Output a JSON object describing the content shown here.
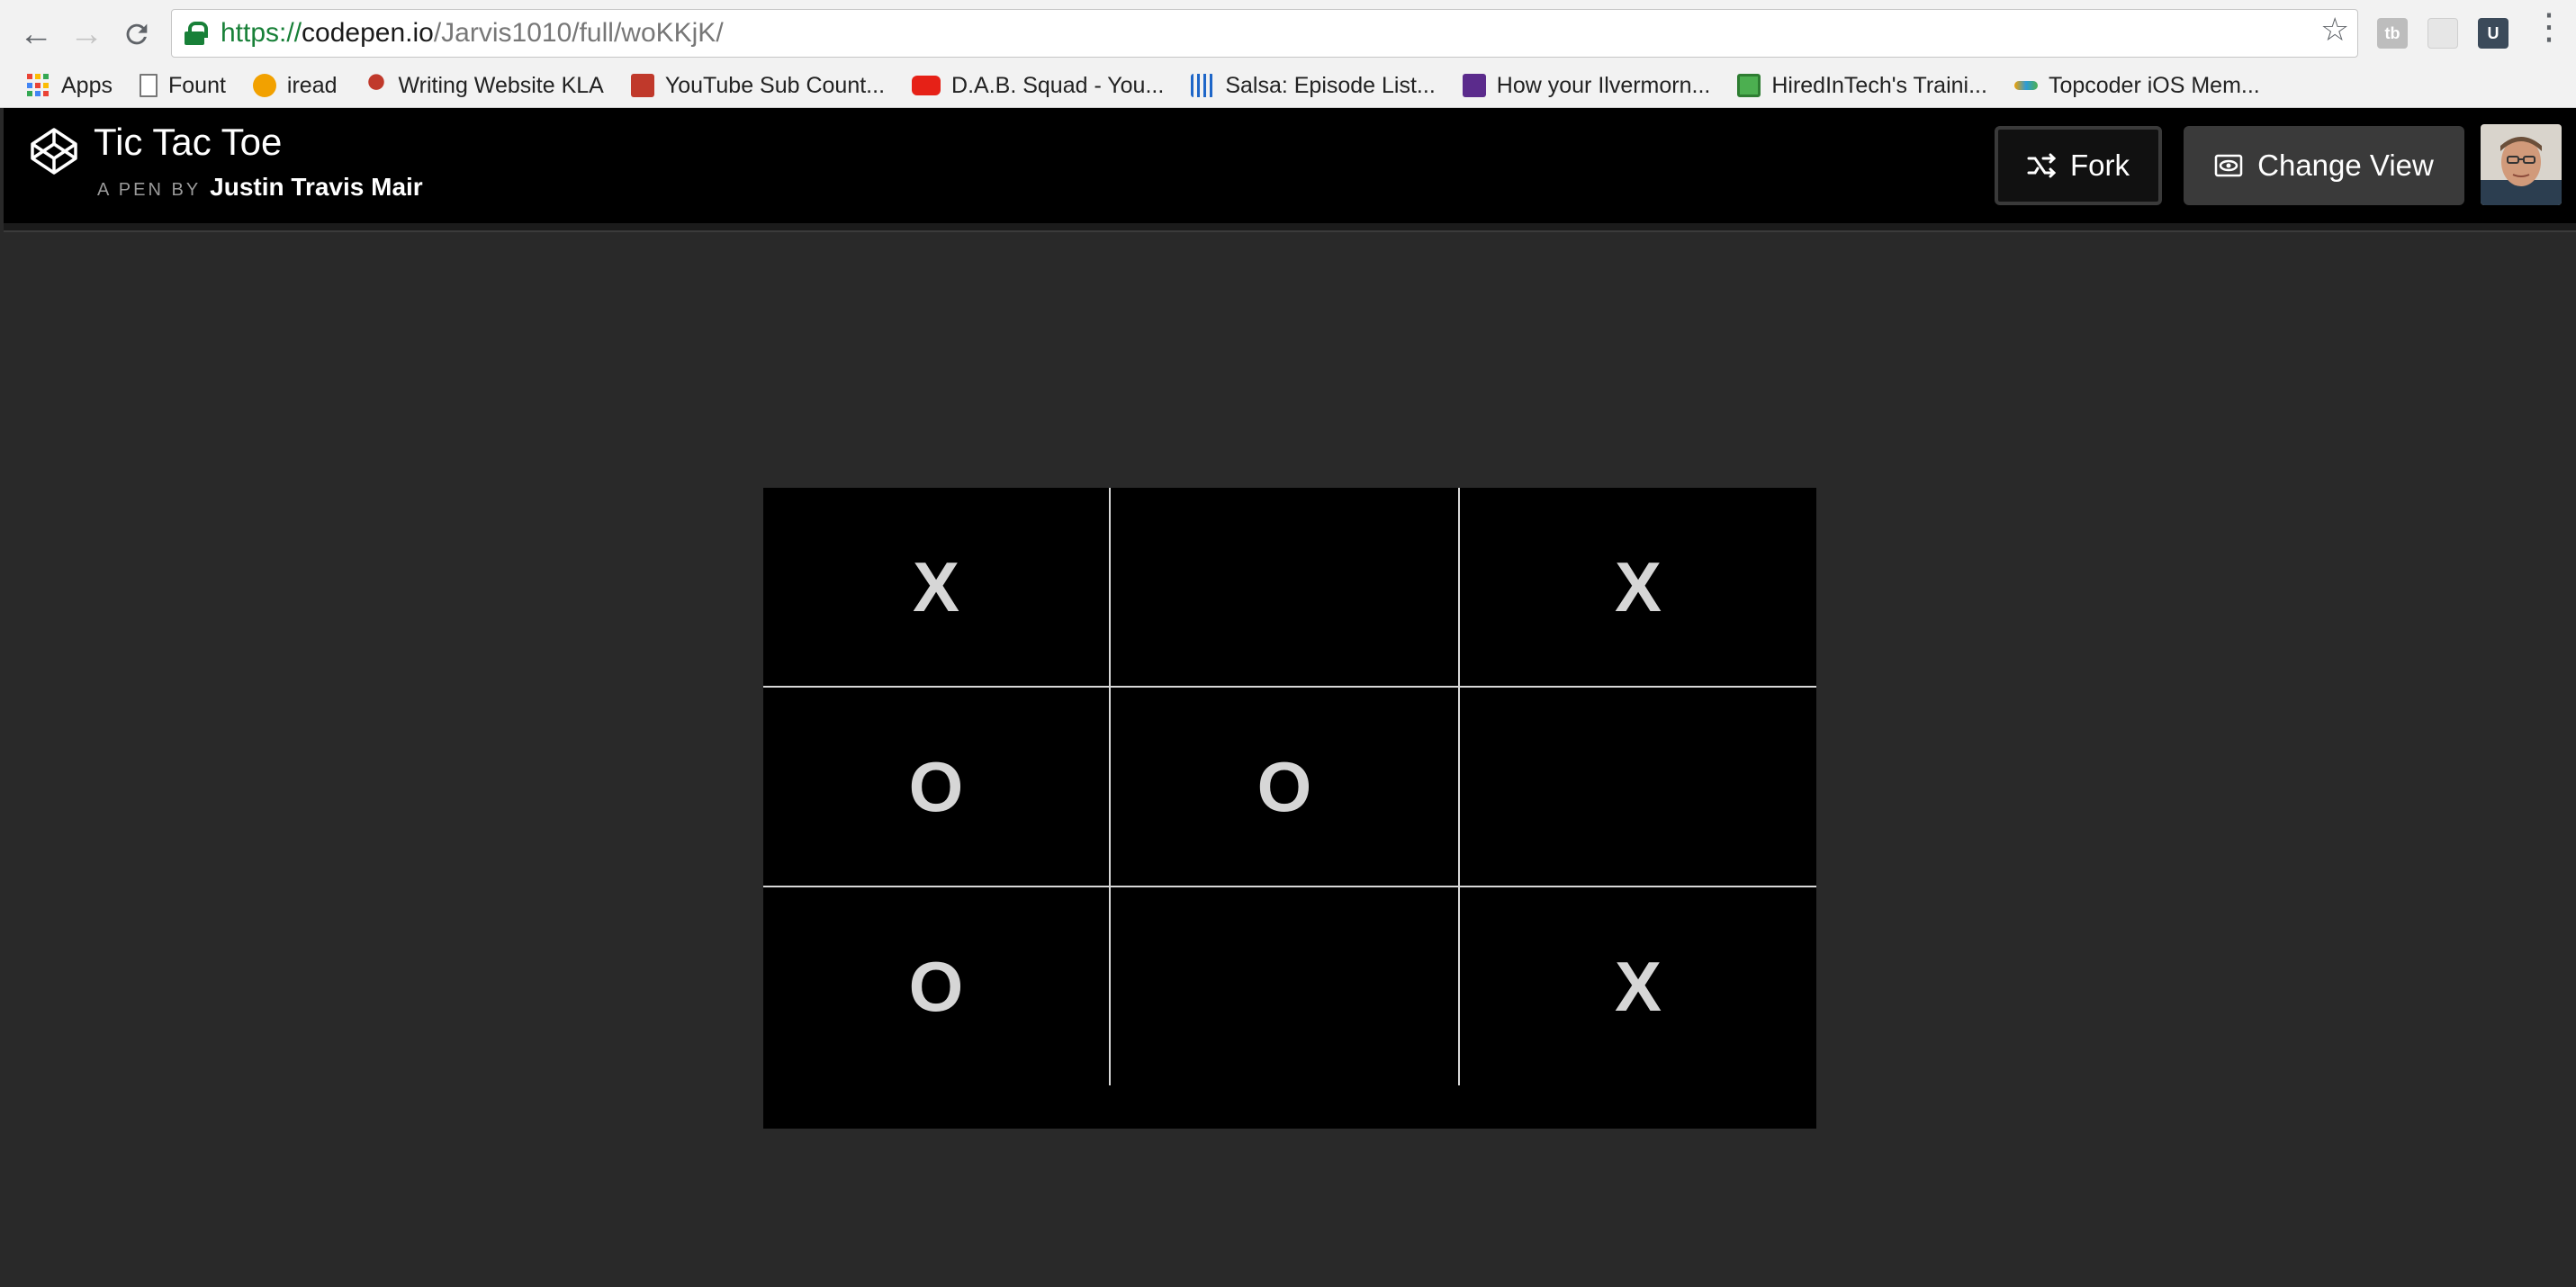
{
  "browser": {
    "url_scheme": "https://",
    "url_host": "codepen.io",
    "url_path": "/Jarvis1010/full/woKKjK/",
    "bookmarks": [
      {
        "label": "Apps",
        "icon": "apps-grid-icon"
      },
      {
        "label": "Fount",
        "icon": "page-icon"
      },
      {
        "label": "iread",
        "icon": "orange-circle-icon"
      },
      {
        "label": "Writing Website KLA",
        "icon": "octopus-icon"
      },
      {
        "label": "YouTube Sub Count...",
        "icon": "ysc-icon"
      },
      {
        "label": "D.A.B. Squad - You...",
        "icon": "youtube-icon"
      },
      {
        "label": "Salsa: Episode List...",
        "icon": "salsa-icon"
      },
      {
        "label": "How your Ilvermorn...",
        "icon": "h-icon"
      },
      {
        "label": "HiredInTech's Traini...",
        "icon": "hiredintech-icon"
      },
      {
        "label": "Topcoder iOS Mem...",
        "icon": "topcoder-icon"
      }
    ],
    "extensions": [
      {
        "label": "tb",
        "icon": "tb-extension-icon"
      },
      {
        "label": "",
        "icon": "extension-icon"
      },
      {
        "label": "U",
        "icon": "u-extension-icon"
      }
    ]
  },
  "codepen": {
    "title": "Tic Tac Toe",
    "byline_prefix": "A PEN BY",
    "author": "Justin Travis Mair",
    "fork_label": "Fork",
    "change_view_label": "Change View"
  },
  "game": {
    "board": [
      [
        "X",
        "",
        "X"
      ],
      [
        "O",
        "O",
        ""
      ],
      [
        "O",
        "",
        "X"
      ]
    ]
  },
  "colors": {
    "page_bg": "#292929",
    "header_bg": "#000000",
    "board_bg": "#000000",
    "mark": "#d6d6d6",
    "grid_line": "#d8d8d8"
  }
}
